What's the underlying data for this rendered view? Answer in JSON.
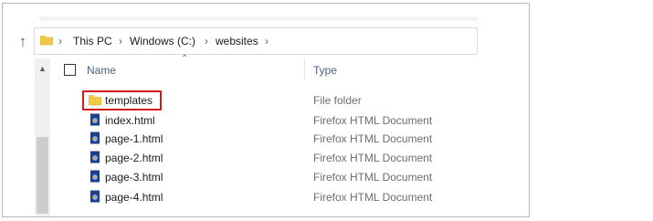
{
  "address_bar": {
    "crumbs": [
      "This PC",
      "Windows (C:)",
      "websites"
    ]
  },
  "columns": {
    "name": "Name",
    "type": "Type"
  },
  "files": [
    {
      "name": "templates",
      "type": "File folder",
      "icon": "folder-icon",
      "highlighted": true
    },
    {
      "name": "index.html",
      "type": "Firefox HTML Document",
      "icon": "html-file-icon"
    },
    {
      "name": "page-1.html",
      "type": "Firefox HTML Document",
      "icon": "html-file-icon"
    },
    {
      "name": "page-2.html",
      "type": "Firefox HTML Document",
      "icon": "html-file-icon"
    },
    {
      "name": "page-3.html",
      "type": "Firefox HTML Document",
      "icon": "html-file-icon"
    },
    {
      "name": "page-4.html",
      "type": "Firefox HTML Document",
      "icon": "html-file-icon"
    }
  ],
  "colors": {
    "highlight": "#d11a1a",
    "folder": "#f3c843",
    "html_icon": "#1d3f8a"
  }
}
